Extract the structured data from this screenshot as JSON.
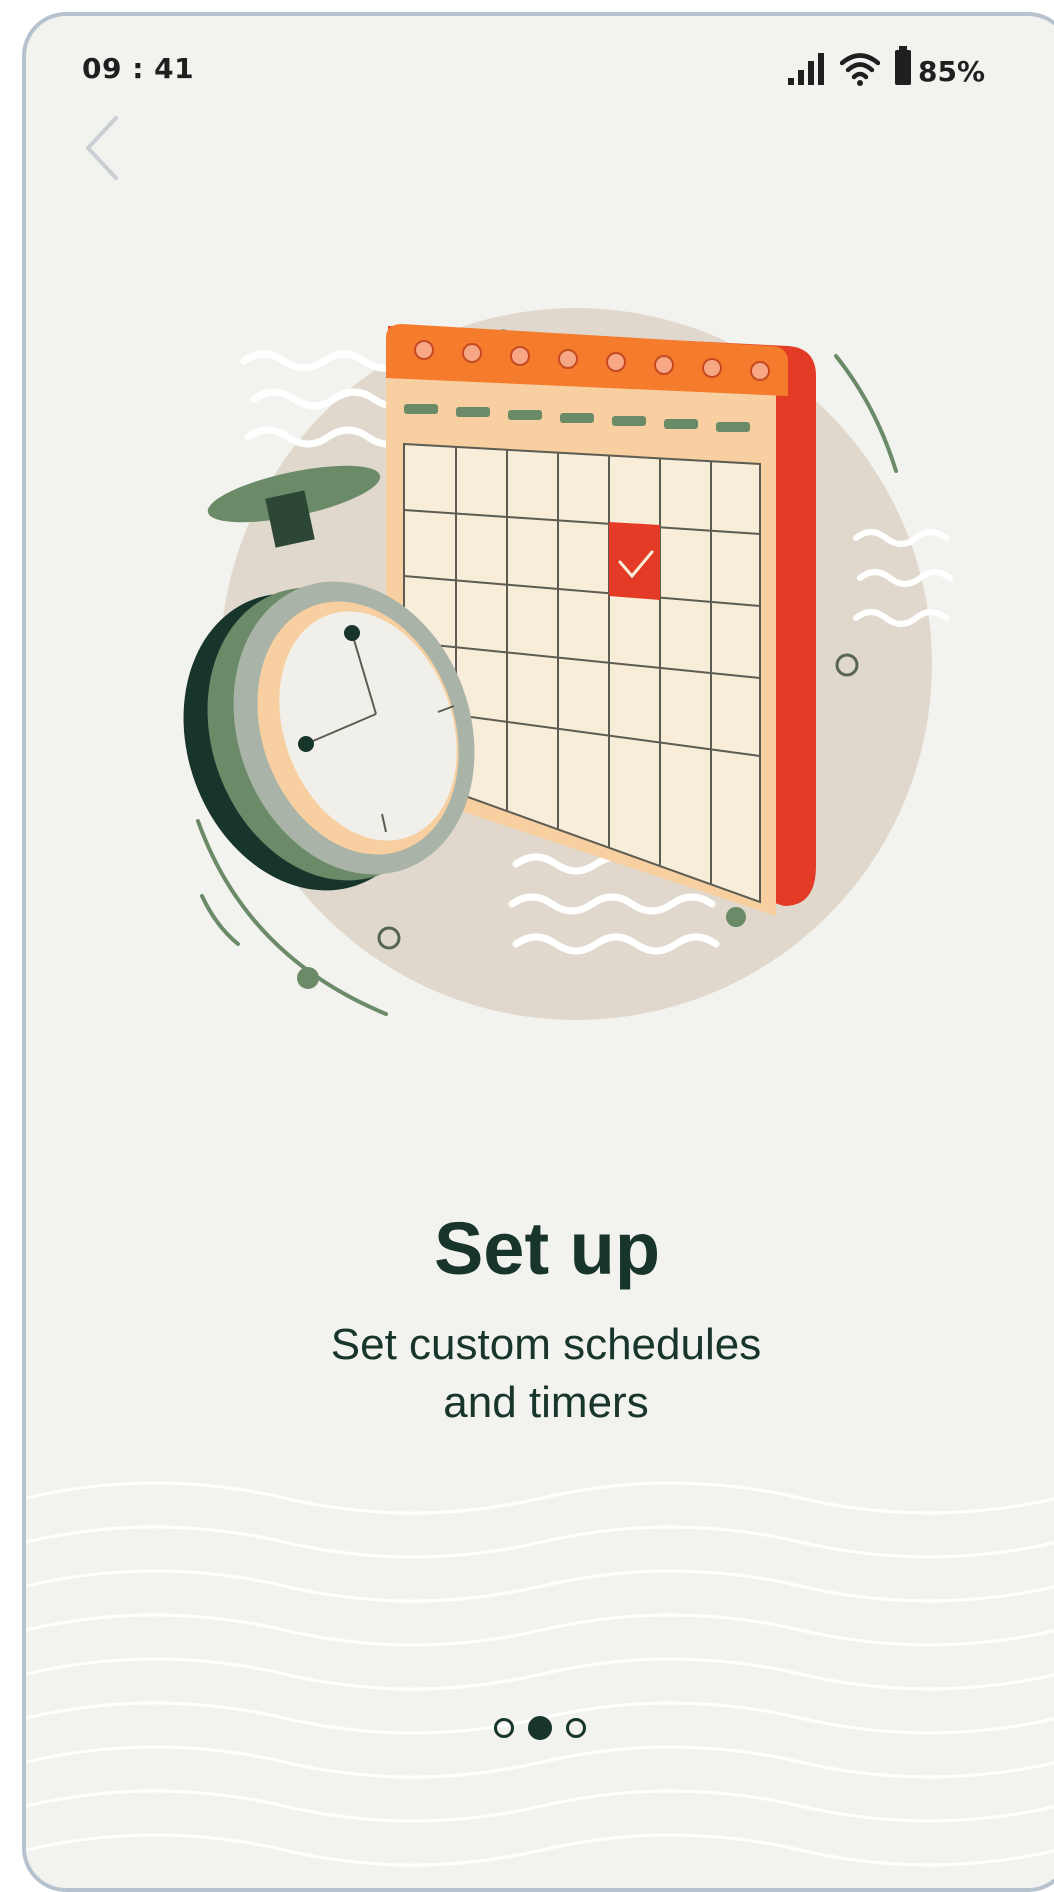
{
  "status_bar": {
    "time": "09 : 41",
    "battery": "85%",
    "icons": [
      "signal-icon",
      "wifi-icon",
      "battery-icon"
    ]
  },
  "navigation": {
    "back_icon": "chevron-left-icon"
  },
  "onboarding": {
    "illustration": "calendar-stopwatch-illustration",
    "title": "Set up",
    "subtitle_line1": "Set custom schedules",
    "subtitle_line2": "and timers"
  },
  "pager": {
    "total": 3,
    "active_index": 1
  },
  "colors": {
    "background": "#f2f2ee",
    "text_dark_green": "#17352b",
    "calendar_red": "#e33b26",
    "calendar_orange": "#f47c2c",
    "calendar_cream": "#f8edd8",
    "sage_green": "#6b8a68",
    "circle_beige": "#e0d8cc"
  }
}
